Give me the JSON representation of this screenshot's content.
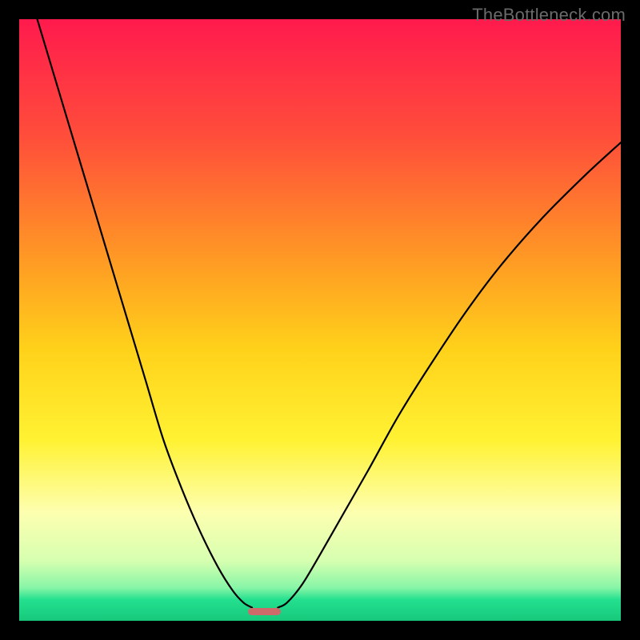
{
  "watermark": "TheBottleneck.com",
  "chart_data": {
    "type": "line",
    "title": "",
    "xlabel": "",
    "ylabel": "",
    "xlim": [
      0,
      1
    ],
    "ylim": [
      0,
      1
    ],
    "grid": false,
    "legend": false,
    "background_gradient": {
      "stops": [
        {
          "offset": 0.0,
          "color": "#ff1a4d"
        },
        {
          "offset": 0.2,
          "color": "#ff4f3a"
        },
        {
          "offset": 0.4,
          "color": "#ff9a24"
        },
        {
          "offset": 0.55,
          "color": "#ffd21a"
        },
        {
          "offset": 0.7,
          "color": "#fff233"
        },
        {
          "offset": 0.82,
          "color": "#fdffb0"
        },
        {
          "offset": 0.9,
          "color": "#d7ffb0"
        },
        {
          "offset": 0.945,
          "color": "#88f5a7"
        },
        {
          "offset": 0.965,
          "color": "#23e08f"
        },
        {
          "offset": 1.0,
          "color": "#17c87b"
        }
      ]
    },
    "series": [
      {
        "name": "left-branch",
        "x": [
          0.03,
          0.06,
          0.09,
          0.12,
          0.15,
          0.18,
          0.21,
          0.24,
          0.27,
          0.3,
          0.33,
          0.355,
          0.373,
          0.387
        ],
        "y": [
          0.0,
          0.1,
          0.2,
          0.3,
          0.4,
          0.5,
          0.6,
          0.7,
          0.78,
          0.85,
          0.91,
          0.95,
          0.97,
          0.978
        ]
      },
      {
        "name": "right-branch",
        "x": [
          0.43,
          0.445,
          0.47,
          0.5,
          0.54,
          0.58,
          0.63,
          0.68,
          0.74,
          0.8,
          0.87,
          0.94,
          1.0
        ],
        "y": [
          0.978,
          0.97,
          0.94,
          0.89,
          0.82,
          0.75,
          0.66,
          0.58,
          0.49,
          0.41,
          0.33,
          0.26,
          0.205
        ]
      }
    ],
    "marker": {
      "x": 0.408,
      "y": 0.985,
      "width_frac": 0.055,
      "height_frac": 0.012,
      "color": "#cf6a6b"
    }
  }
}
